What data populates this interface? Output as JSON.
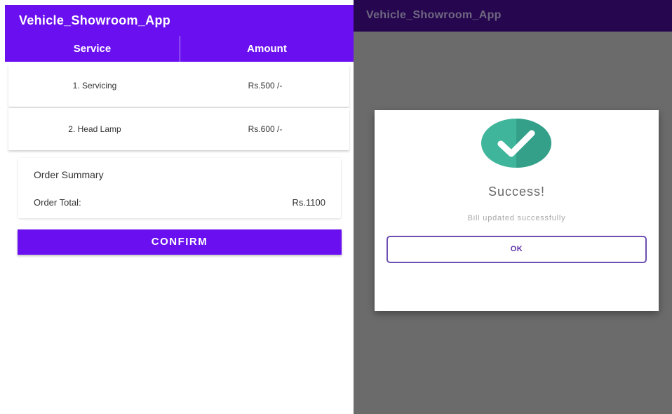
{
  "left_screen": {
    "app_title": "Vehicle_Showroom_App",
    "table": {
      "headers": [
        "Service",
        "Amount"
      ],
      "rows": [
        {
          "service": "1. Servicing",
          "amount": "Rs.500 /-"
        },
        {
          "service": "2. Head Lamp",
          "amount": "Rs.600 /-"
        }
      ]
    },
    "summary": {
      "title": "Order Summary",
      "total_label": "Order Total:",
      "total_value": "Rs.1100"
    },
    "confirm_label": "CONFIRM"
  },
  "right_screen": {
    "app_title": "Vehicle_Showroom_App",
    "dialog": {
      "icon": "check-circle-icon",
      "title": "Success!",
      "message": "Bill updated successfully",
      "ok_label": "OK"
    }
  },
  "colors": {
    "primary": "#6a0ff0",
    "dim_appbar": "#26074f",
    "overlay": "#6b6b6b",
    "success_green": "#3fb59b",
    "ok_border": "#6c4fb0"
  }
}
